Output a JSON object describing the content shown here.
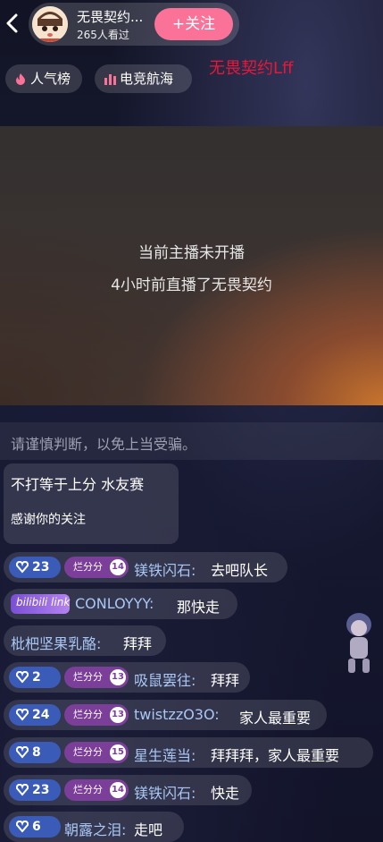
{
  "header": {
    "host_name": "无畏契约...",
    "viewers": "265人看过",
    "follow_label": "+关注"
  },
  "chips": [
    {
      "label": "人气榜",
      "icon": "flame-icon"
    },
    {
      "label": "电竞航海",
      "icon": "bars-icon"
    }
  ],
  "watermark": "无畏契约Lff",
  "player": {
    "line1": "当前主播未开播",
    "line2": "4小时前直播了无畏契约"
  },
  "chat": {
    "notice": "请谨慎判断，以免上当受骗。",
    "pinned": {
      "title": "不打等于上分 水友赛",
      "subtitle": "感谢你的关注"
    },
    "messages": [
      {
        "level": "23",
        "medal": "烂分分",
        "medal_level": "14",
        "user": "镁铁闪石:",
        "text": "去吧队长"
      },
      {
        "badge": "bilibili link",
        "user": "CONLOYYY:",
        "text": "那快走"
      },
      {
        "user": "枇杷坚果乳酪:",
        "text": "拜拜"
      },
      {
        "level": "2",
        "medal": "烂分分",
        "medal_level": "13",
        "user": "吸鼠罢往:",
        "text": "拜拜"
      },
      {
        "level": "24",
        "medal": "烂分分",
        "medal_level": "13",
        "user": "twistzzO3O:",
        "text": "家人最重要"
      },
      {
        "level": "8",
        "medal": "烂分分",
        "medal_level": "15",
        "user": "星生莲当:",
        "text": "拜拜拜，家人最重要"
      },
      {
        "level": "23",
        "medal": "烂分分",
        "medal_level": "14",
        "user": "镁铁闪石:",
        "text": "快走"
      },
      {
        "level": "6",
        "user": "朝露之泪:",
        "text": "走吧"
      }
    ]
  },
  "colors": {
    "follow": "#fb7299",
    "level_badge": "#3a5bb8",
    "medal": "#7b3e99",
    "username": "#a9c7f5",
    "watermark": "#e8173a"
  }
}
